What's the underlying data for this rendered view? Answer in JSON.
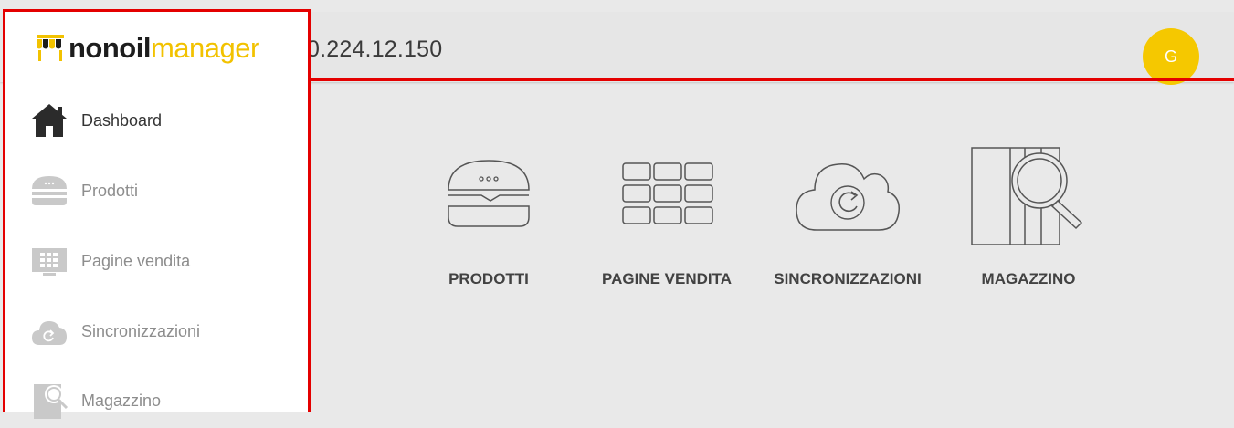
{
  "header": {
    "server_address": "0.224.12.150",
    "user_initial": "G"
  },
  "logo": {
    "part1": "nonoil",
    "part2": "manager"
  },
  "sidebar": {
    "items": [
      {
        "label": "Dashboard",
        "icon": "home-icon",
        "active": true
      },
      {
        "label": "Prodotti",
        "icon": "burger-icon",
        "active": false
      },
      {
        "label": "Pagine vendita",
        "icon": "grid-icon",
        "active": false
      },
      {
        "label": "Sincronizzazioni",
        "icon": "cloud-sync-icon",
        "active": false
      },
      {
        "label": "Magazzino",
        "icon": "warehouse-search-icon",
        "active": false
      }
    ]
  },
  "dashboard": {
    "tiles": [
      {
        "label": "PRODOTTI",
        "icon": "burger-icon"
      },
      {
        "label": "PAGINE VENDITA",
        "icon": "grid-icon"
      },
      {
        "label": "SINCRONIZZAZIONI",
        "icon": "cloud-sync-icon"
      },
      {
        "label": "MAGAZZINO",
        "icon": "warehouse-search-icon"
      }
    ]
  },
  "colors": {
    "accent": "#f5c800",
    "highlight_border": "#e40000",
    "background": "#e9e9e9"
  }
}
